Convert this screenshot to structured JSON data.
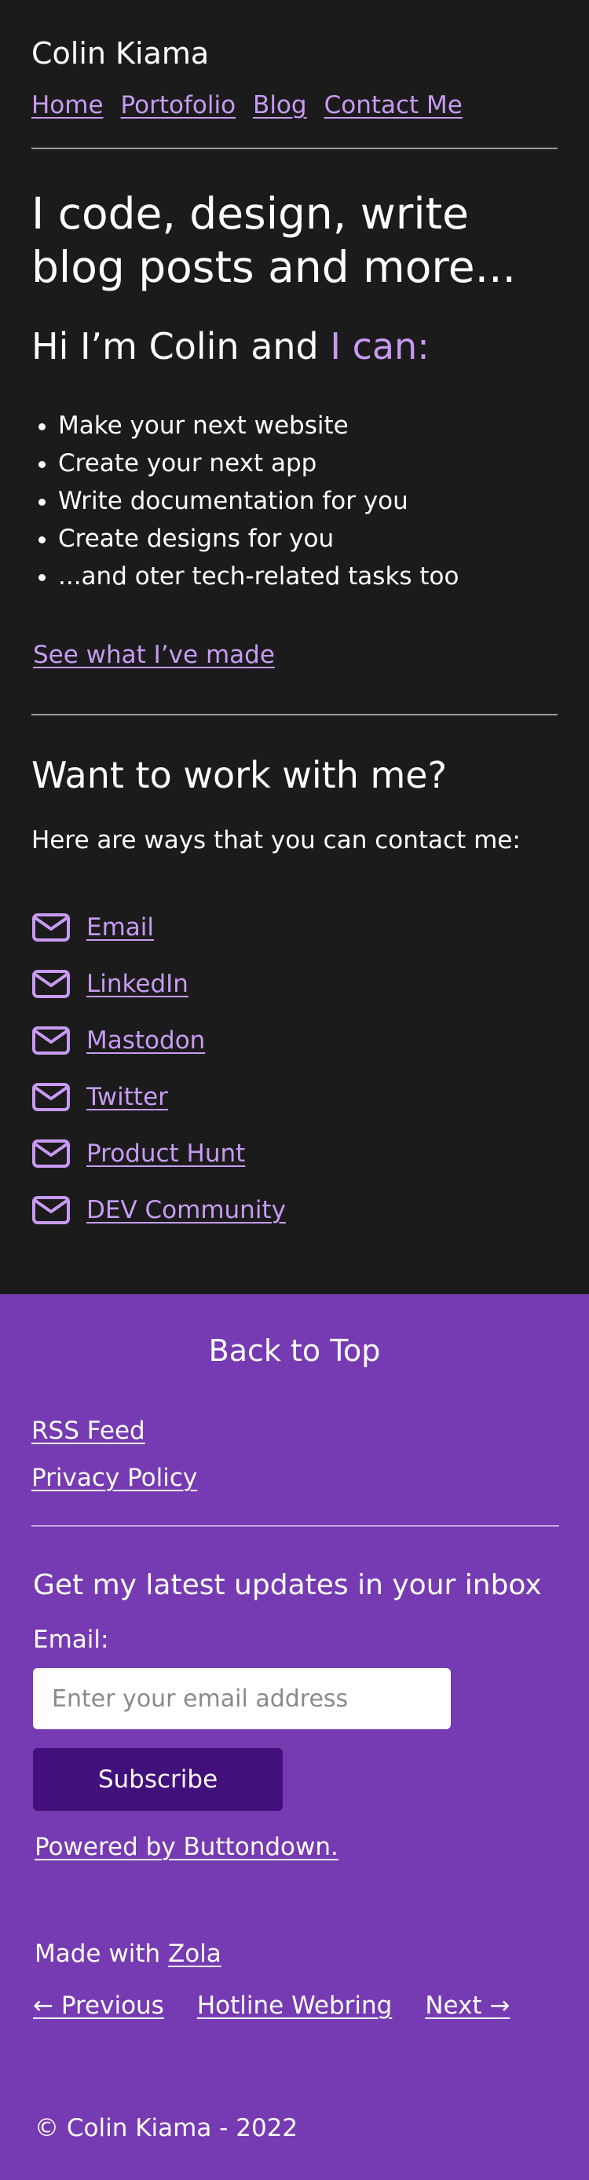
{
  "site": {
    "title": "Colin Kiama"
  },
  "nav": [
    {
      "label": "Home"
    },
    {
      "label": "Portofolio"
    },
    {
      "label": "Blog"
    },
    {
      "label": "Contact Me"
    }
  ],
  "hero": {
    "heading": "I code, design, write blog posts and more..."
  },
  "intro": {
    "prefix": "Hi I’m Colin and ",
    "accent": "I can:"
  },
  "skills": [
    "Make your next website",
    "Create your next app",
    "Write documentation for you",
    "Create designs for you",
    "...and oter tech-related tasks too"
  ],
  "portfolio_link": "See what I’ve made",
  "work": {
    "heading": "Want to work with me?",
    "text": "Here are ways that you can contact me:",
    "contacts": [
      {
        "label": "Email",
        "icon": "envelope-icon"
      },
      {
        "label": "LinkedIn",
        "icon": "envelope-icon"
      },
      {
        "label": "Mastodon",
        "icon": "envelope-icon"
      },
      {
        "label": "Twitter",
        "icon": "envelope-icon"
      },
      {
        "label": "Product Hunt",
        "icon": "envelope-icon"
      },
      {
        "label": "DEV Community",
        "icon": "envelope-icon"
      }
    ]
  },
  "footer": {
    "back_to_top": "Back to Top",
    "rss": "RSS Feed",
    "privacy": "Privacy Policy",
    "updates_heading": "Get my latest updates in your inbox",
    "email_label": "Email:",
    "email_placeholder": "Enter your email address",
    "subscribe_label": "Subscribe",
    "powered": "Powered by Buttondown.",
    "made_with": "Made with ",
    "made_with_link": "Zola",
    "webring": {
      "previous": "← Previous",
      "name": "Hotline Webring",
      "next": "Next →"
    },
    "copyright": "© Colin Kiama - 2022"
  },
  "colors": {
    "background": "#1b1b1b",
    "accent": "#c79bf2",
    "footer_bg": "#763ab2",
    "button_bg": "#42107a"
  }
}
